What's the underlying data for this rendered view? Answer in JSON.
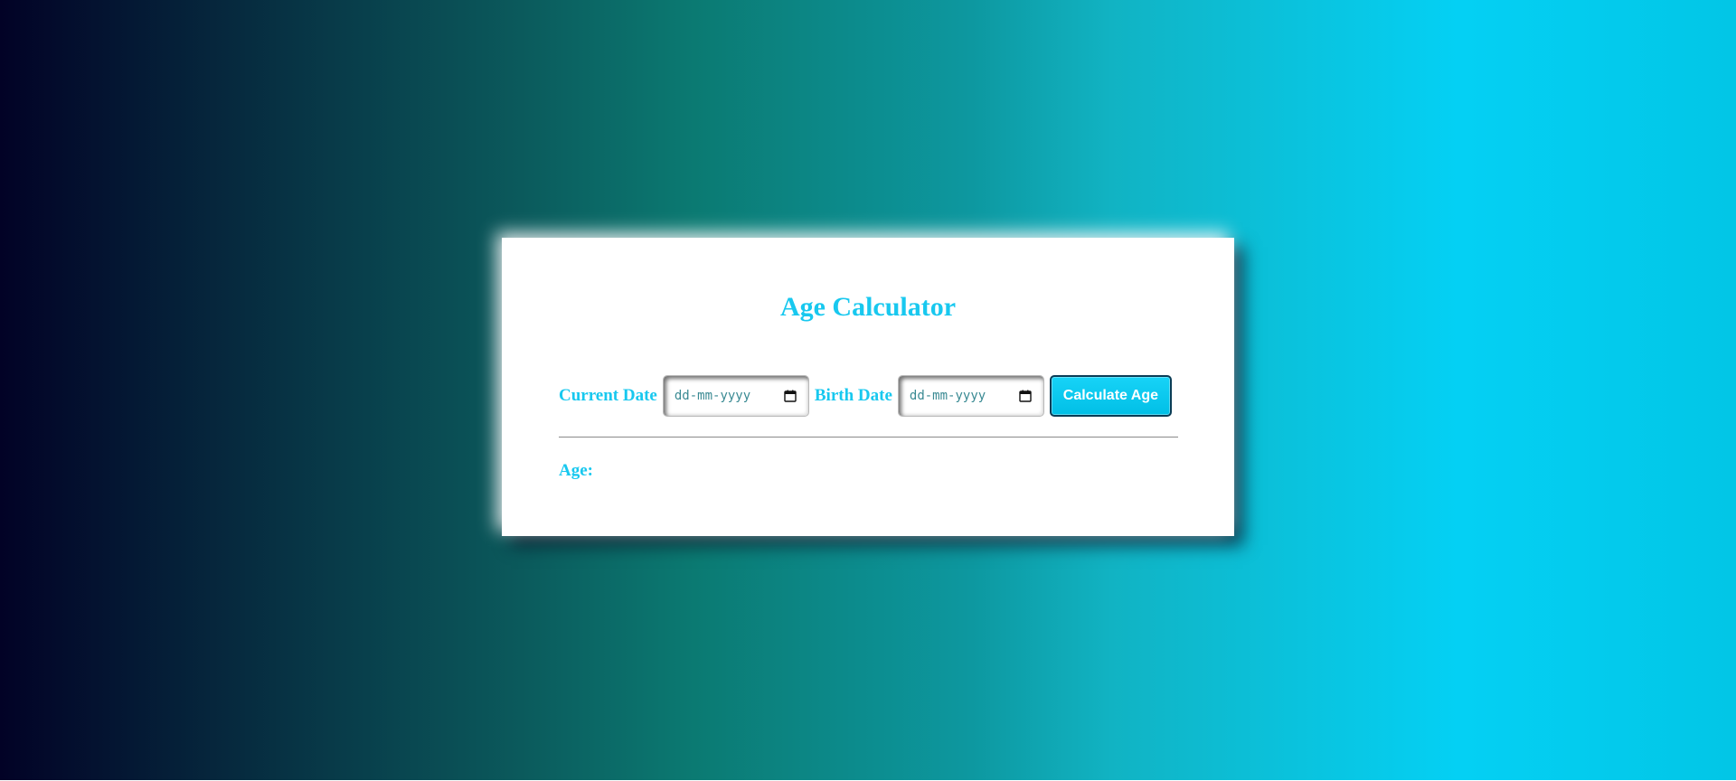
{
  "colors": {
    "accent": "#18c8ef",
    "button_fill": "#01bfe6",
    "card_background": "#ffffff",
    "gradient_left": "#020226",
    "gradient_mid": "#0b7a72",
    "gradient_right": "#04d0f4"
  },
  "card": {
    "title": "Age Calculator"
  },
  "form": {
    "current_date": {
      "label": "Current Date",
      "placeholder": "dd-mm-yyyy",
      "value": "",
      "icon": "calendar-icon"
    },
    "birth_date": {
      "label": "Birth Date",
      "placeholder": "dd-mm-yyyy",
      "value": "",
      "icon": "calendar-icon"
    },
    "button_label": "Calculate Age"
  },
  "result": {
    "label": "Age:",
    "value": ""
  }
}
